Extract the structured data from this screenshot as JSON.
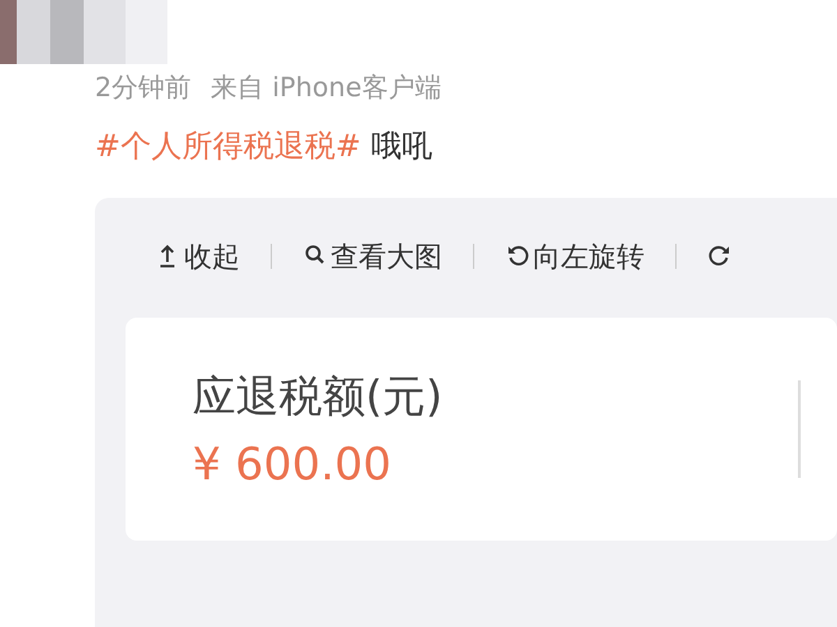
{
  "post": {
    "time": "2分钟前",
    "source": "来自 iPhone客户端",
    "hashtag": "#个人所得税退税#",
    "text": "哦吼"
  },
  "toolbar": [
    {
      "kind": "collapse",
      "label": "收起"
    },
    {
      "kind": "zoom",
      "label": "查看大图"
    },
    {
      "kind": "rotate-left",
      "label": "向左旋转"
    },
    {
      "kind": "rotate-right"
    }
  ],
  "card": {
    "label": "应退税额(元)",
    "amount": "¥ 600.00"
  }
}
